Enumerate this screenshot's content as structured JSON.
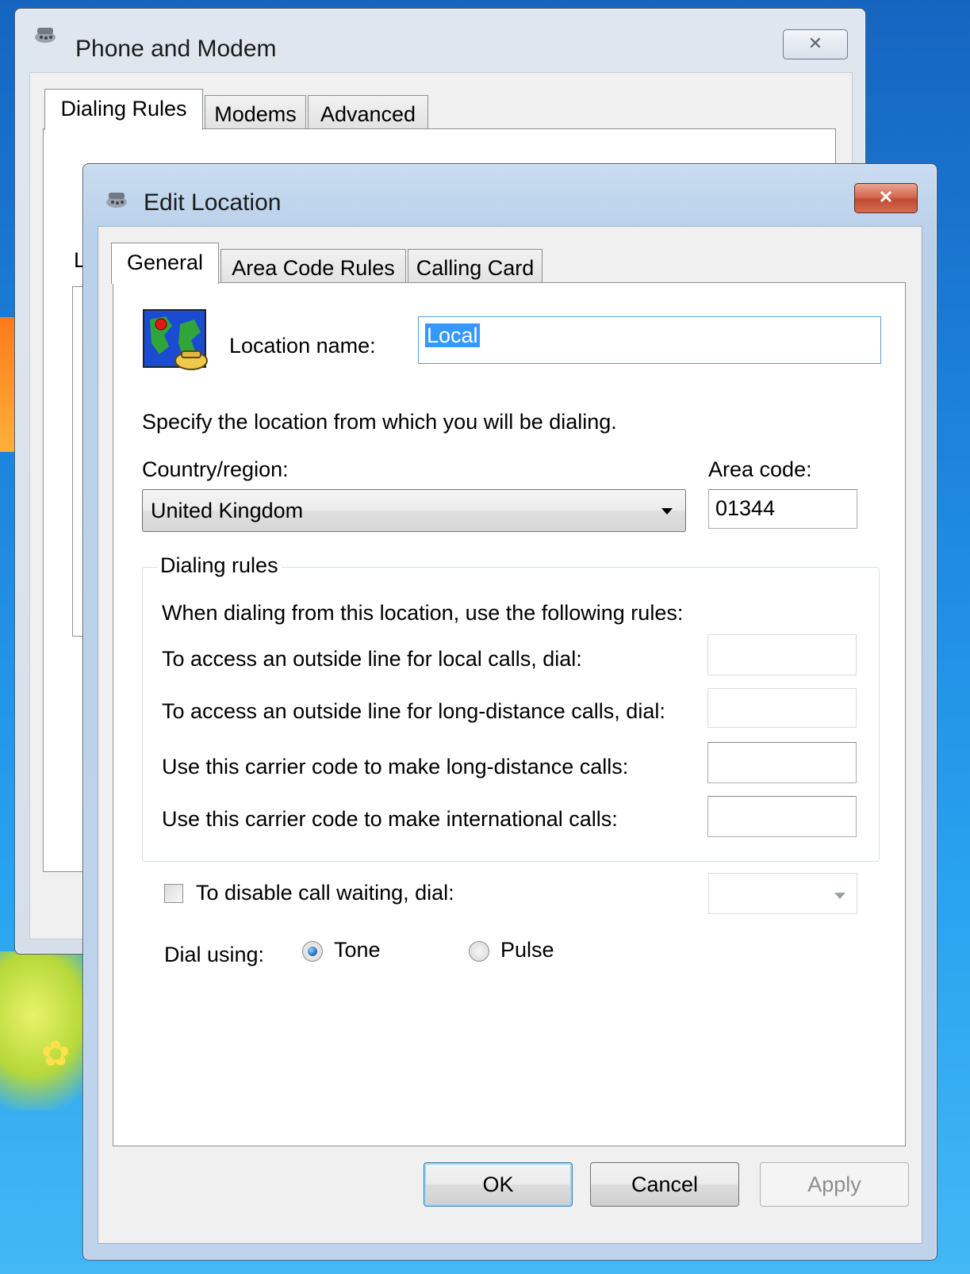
{
  "background_window": {
    "title": "Phone and Modem",
    "tabs": [
      "Dialing Rules",
      "Modems",
      "Advanced"
    ],
    "close_glyph": "✕",
    "partial_label": "L"
  },
  "dialog": {
    "title": "Edit Location",
    "close_glyph": "✕",
    "tabs": [
      "General",
      "Area Code Rules",
      "Calling Card"
    ],
    "location_name_label": "Location name:",
    "location_name_value": "Local",
    "specify_text": "Specify the location from which you will be dialing.",
    "country_label": "Country/region:",
    "country_value": "United Kingdom",
    "area_code_label": "Area code:",
    "area_code_value": "01344",
    "dialing_rules": {
      "title": "Dialing rules",
      "intro": "When dialing from this location, use the following rules:",
      "local_label": "To access an outside line for local calls, dial:",
      "local_value": "",
      "long_distance_label": "To access an outside line for long-distance calls, dial:",
      "long_distance_value": "",
      "carrier_ld_label": "Use this carrier code to make long-distance calls:",
      "carrier_ld_value": "",
      "carrier_intl_label": "Use this carrier code to make international calls:",
      "carrier_intl_value": ""
    },
    "call_waiting_label": "To disable call waiting, dial:",
    "call_waiting_checked": false,
    "dial_using_label": "Dial using:",
    "tone_label": "Tone",
    "pulse_label": "Pulse",
    "dial_mode": "Tone",
    "buttons": {
      "ok": "OK",
      "cancel": "Cancel",
      "apply": "Apply"
    }
  },
  "colors": {
    "accent": "#3399ff",
    "close_red": "#c24a30",
    "desktop": "#1e88e0"
  },
  "icons": [
    "phone-modem-icon",
    "location-globe-icon",
    "dropdown-arrow-icon",
    "close-icon"
  ]
}
